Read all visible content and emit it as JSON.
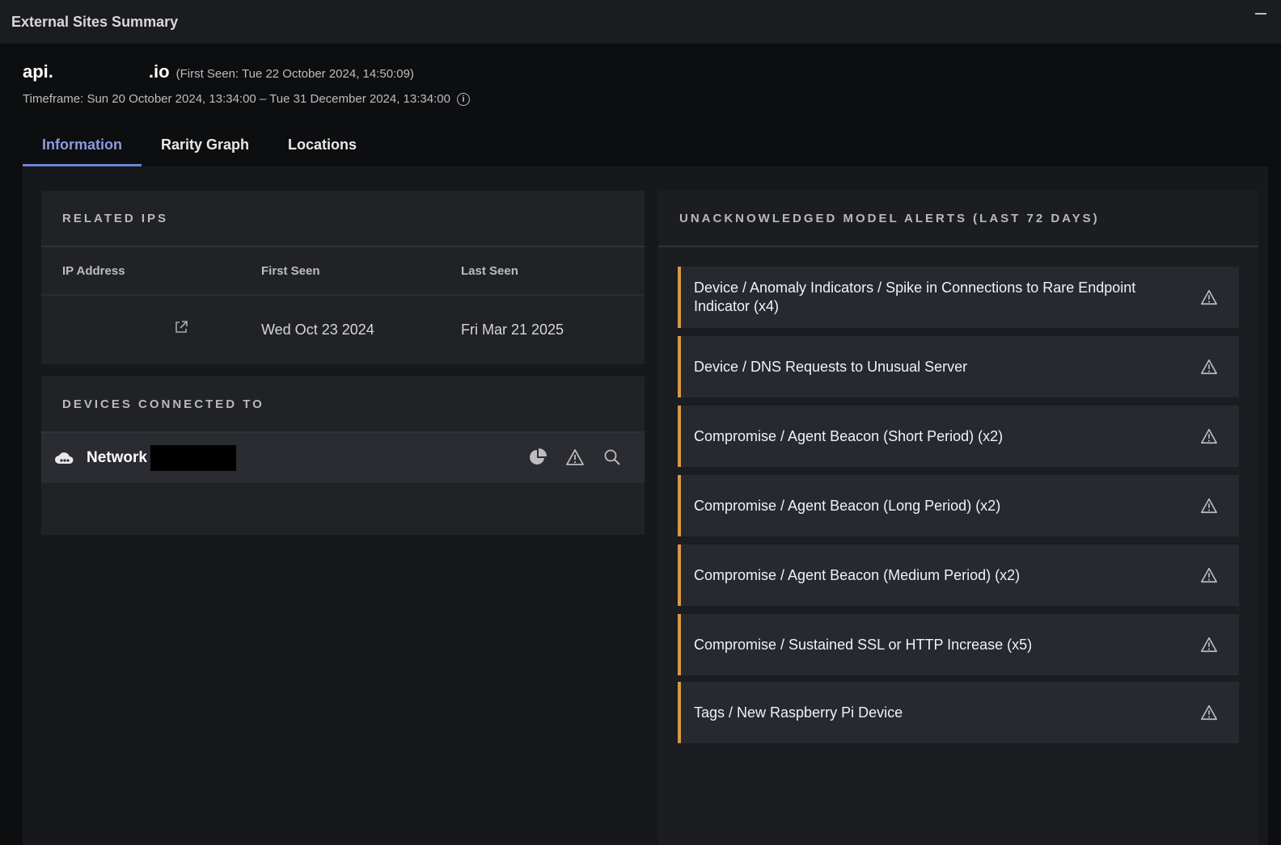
{
  "window": {
    "title": "External Sites Summary"
  },
  "header": {
    "domain_prefix": "api.",
    "domain_suffix": ".io",
    "first_seen": "(First Seen: Tue 22 October 2024, 14:50:09)",
    "timeframe": "Timeframe: Sun 20 October 2024, 13:34:00 – Tue 31 December 2024, 13:34:00"
  },
  "tabs": [
    {
      "label": "Information",
      "active": true
    },
    {
      "label": "Rarity Graph",
      "active": false
    },
    {
      "label": "Locations",
      "active": false
    }
  ],
  "related_ips": {
    "title": "RELATED IPS",
    "columns": [
      "IP Address",
      "First Seen",
      "Last Seen"
    ],
    "rows": [
      {
        "ip": "",
        "first_seen": "Wed Oct 23 2024",
        "last_seen": "Fri Mar 21 2025"
      }
    ]
  },
  "devices": {
    "title": "DEVICES CONNECTED TO",
    "items": [
      {
        "name": "Network"
      }
    ]
  },
  "alerts": {
    "title": "UNACKNOWLEDGED MODEL ALERTS (LAST 72 DAYS)",
    "accent_color": "#d89a45",
    "items": [
      "Device / Anomaly Indicators / Spike in Connections to Rare Endpoint Indicator (x4)",
      "Device / DNS Requests to Unusual Server",
      "Compromise / Agent Beacon (Short Period) (x2)",
      "Compromise / Agent Beacon (Long Period) (x2)",
      "Compromise / Agent Beacon (Medium Period) (x2)",
      "Compromise / Sustained SSL or HTTP Increase (x5)",
      "Tags / New Raspberry Pi Device"
    ]
  }
}
